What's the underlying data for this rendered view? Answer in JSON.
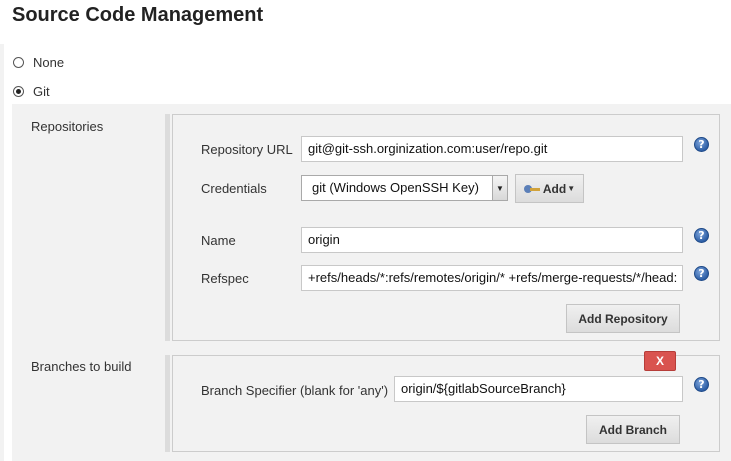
{
  "section": {
    "title": "Source Code Management"
  },
  "scm_options": [
    {
      "label": "None",
      "selected": false
    },
    {
      "label": "Git",
      "selected": true
    }
  ],
  "repositories": {
    "label": "Repositories",
    "url_label": "Repository URL",
    "url_value": "git@git-ssh.orginization.com:user/repo.git",
    "credentials_label": "Credentials",
    "credentials_value": "git (Windows OpenSSH Key)",
    "add_label": "Add",
    "name_label": "Name",
    "name_value": "origin",
    "refspec_label": "Refspec",
    "refspec_value": "+refs/heads/*:refs/remotes/origin/* +refs/merge-requests/*/head:",
    "add_repository_label": "Add Repository"
  },
  "branches": {
    "label": "Branches to build",
    "delete_label": "X",
    "specifier_label": "Branch Specifier (blank for 'any')",
    "specifier_value": "origin/${gitlabSourceBranch}",
    "add_branch_label": "Add Branch"
  },
  "icons": {
    "help": "help-icon",
    "key": "key-icon",
    "radio": "radio-icon"
  },
  "colors": {
    "panel_bg": "#f2f2f2",
    "help_blue": "#2e5fa6",
    "delete_red": "#d9534f"
  }
}
